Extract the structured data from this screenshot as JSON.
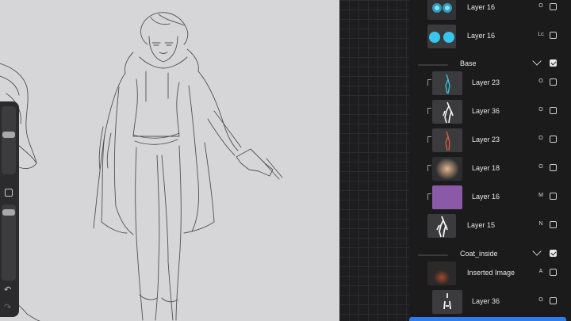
{
  "canvas": {
    "background": "#d6d5d8",
    "sketch_color": "#3a3a3e"
  },
  "toolbar": {
    "undo_icon": "undo-arrow-icon",
    "redo_icon": "redo-arrow-icon",
    "modify_icon": "square-icon"
  },
  "layers_panel": {
    "rows": [
      {
        "kind": "layer",
        "name": "Layer 16",
        "blend": "O",
        "thumb": "cyan-glow-dots",
        "visible": false
      },
      {
        "kind": "layer",
        "name": "Layer 16",
        "blend": "Lc",
        "thumb": "cyan-dots",
        "visible": false
      },
      {
        "kind": "group",
        "name": "Base",
        "visible": true
      },
      {
        "kind": "layer",
        "name": "Layer 23",
        "blend": "O",
        "thumb": "cyan-figure",
        "clipped": true,
        "visible": false
      },
      {
        "kind": "layer",
        "name": "Layer 36",
        "blend": "O",
        "thumb": "white-figure",
        "clipped": true,
        "visible": false
      },
      {
        "kind": "layer",
        "name": "Layer 23",
        "blend": "O",
        "thumb": "red-figure",
        "clipped": true,
        "visible": false
      },
      {
        "kind": "layer",
        "name": "Layer 18",
        "blend": "O",
        "thumb": "beige-blur",
        "clipped": true,
        "visible": false
      },
      {
        "kind": "layer",
        "name": "Layer 16",
        "blend": "M",
        "thumb": "purple-fill",
        "clipped": true,
        "visible": false
      },
      {
        "kind": "layer",
        "name": "Layer 15",
        "blend": "N",
        "thumb": "white-figure",
        "visible": false
      },
      {
        "kind": "group",
        "name": "Coat_inside",
        "visible": true
      },
      {
        "kind": "layer",
        "name": "Inserted Image",
        "blend": "A",
        "thumb": "orange-glow",
        "visible": false
      },
      {
        "kind": "layer",
        "name": "Layer 36",
        "blend": "O",
        "thumb": "white-figure",
        "visible": false
      }
    ]
  },
  "colors": {
    "selection": "#2d7bf0",
    "panel": "#1b1b1c",
    "cyan": "#38c6ee",
    "purple": "#8a5aa8"
  }
}
